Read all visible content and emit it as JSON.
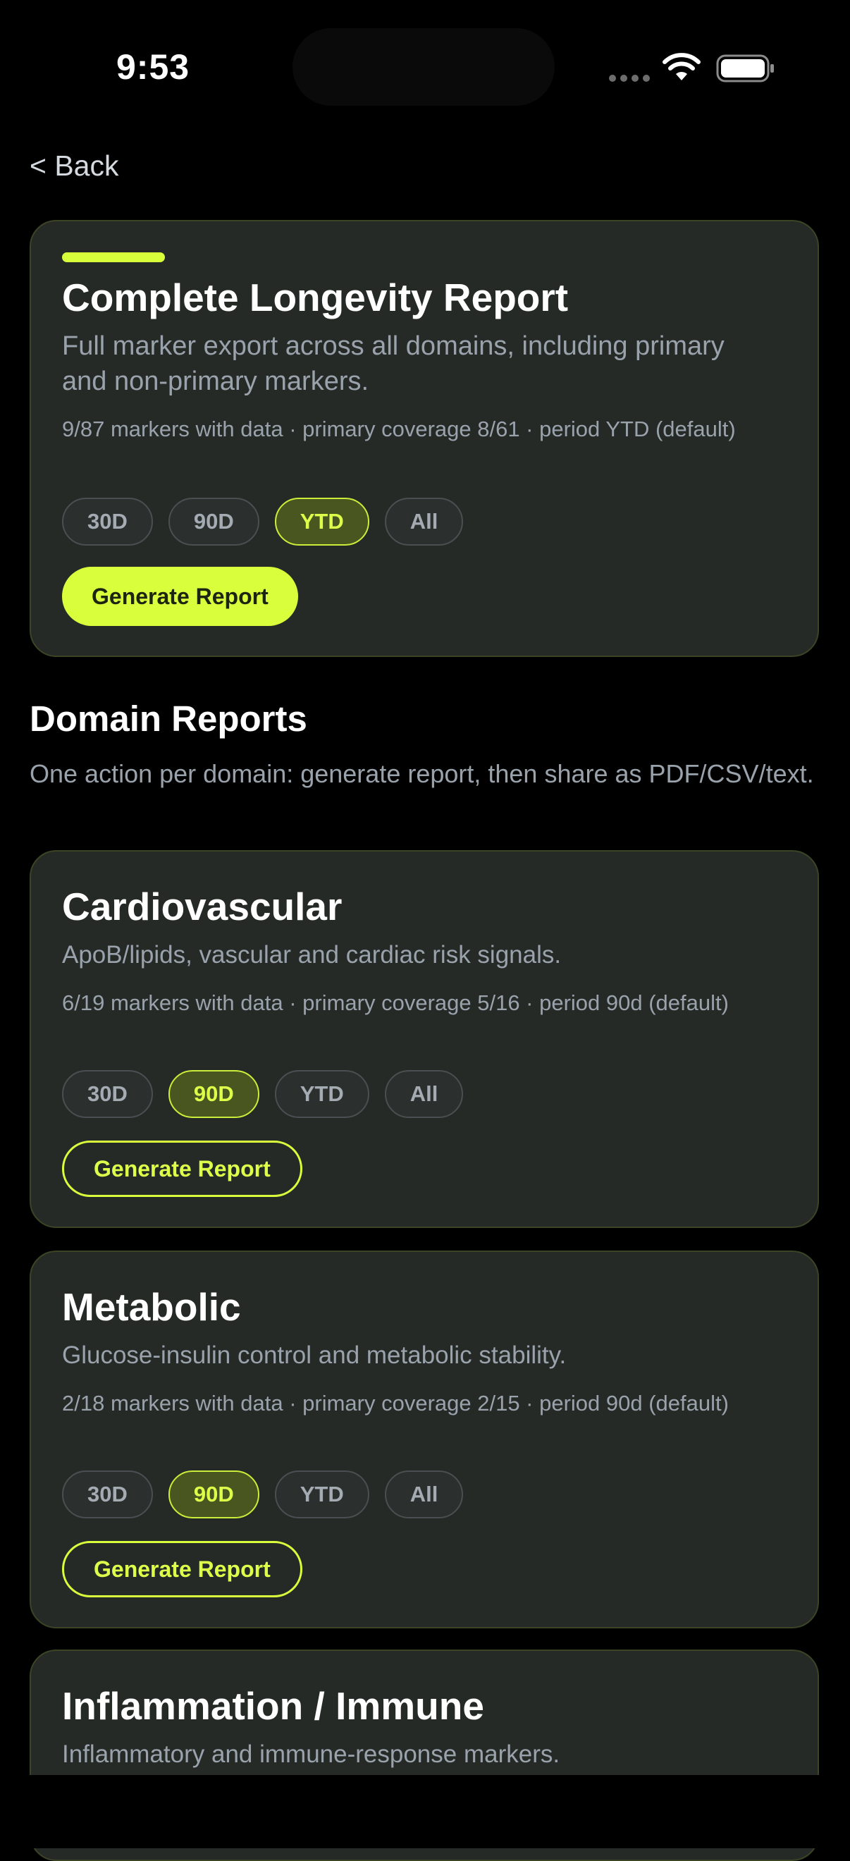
{
  "status_bar": {
    "time": "9:53"
  },
  "nav": {
    "back_label": "< Back"
  },
  "full_report": {
    "title": "Complete Longevity Report",
    "description": "Full marker export across all domains, including primary and non-primary markers.",
    "meta": "9/87 markers with data · primary coverage 8/61 · period YTD (default)",
    "periods": [
      "30D",
      "90D",
      "YTD",
      "All"
    ],
    "selected_period": "YTD",
    "button_label": "Generate Report"
  },
  "domain_section": {
    "title": "Domain Reports",
    "subtitle": "One action per domain: generate report, then share as PDF/CSV/text."
  },
  "domains": [
    {
      "title": "Cardiovascular",
      "description": "ApoB/lipids, vascular and cardiac risk signals.",
      "meta": "6/19 markers with data · primary coverage 5/16 · period 90d (default)",
      "periods": [
        "30D",
        "90D",
        "YTD",
        "All"
      ],
      "selected_period": "90D",
      "button_label": "Generate Report"
    },
    {
      "title": "Metabolic",
      "description": "Glucose-insulin control and metabolic stability.",
      "meta": "2/18 markers with data · primary coverage 2/15 · period 90d (default)",
      "periods": [
        "30D",
        "90D",
        "YTD",
        "All"
      ],
      "selected_period": "90D",
      "button_label": "Generate Report"
    },
    {
      "title": "Inflammation / Immune",
      "description": "Inflammatory and immune-response markers."
    }
  ],
  "colors": {
    "accent": "#d9ff3c",
    "card_bg": "#252a27",
    "card_border": "#3b4526",
    "muted_text": "#9aa2ac",
    "background": "#000000"
  }
}
